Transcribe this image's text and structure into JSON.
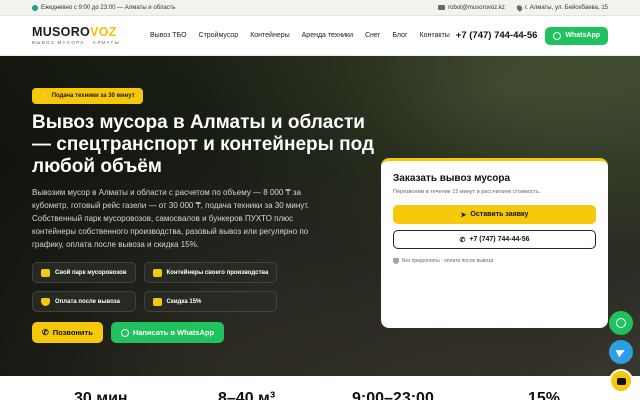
{
  "topbar": {
    "hours": "Ежедневно с 9:00 до 23:00 — Алматы и область",
    "email": "robot@musorovoz.kz",
    "address": "г. Алматы, ул. Бейсебаева, 15"
  },
  "header": {
    "logo_part1": "MUSORO",
    "logo_part2": "VOZ",
    "logo_sub": "ВЫВОЗ МУСОРА · АЛМАТЫ",
    "nav": [
      "Вывоз ТБО",
      "Строймусор",
      "Контейнеры",
      "Аренда техники",
      "Снег",
      "Блог",
      "Контакты"
    ],
    "phone": "+7 (747) 744-44-56",
    "whatsapp": "WhatsApp"
  },
  "hero": {
    "badge": "Подача техники за 30 минут",
    "title": "Вывоз мусора в Алматы и области — спецтранспорт и контейнеры под любой объём",
    "lead": "Вывозим мусор в Алматы и области с расчетом по объему — 8 000 ₸ за кубометр, готовый рейс газели — от 30 000 ₸, подача техники за 30 минут. Собственный парк мусоровозов, самосвалов и бункеров ПУХТО плюс контейнеры собственного производства, разовый вывоз или регулярно по графику, оплата после вывоза и скидка 15%.",
    "features": [
      "Свой парк мусоровозов",
      "Контейнеры своего производства",
      "Оплата после вывоза",
      "Скидка 15%"
    ],
    "call_btn": "Позвонить",
    "wa_btn": "Написать в WhatsApp"
  },
  "order_card": {
    "title": "Заказать вывоз мусора",
    "subtitle": "Перезвоним в течение 15 минут и рассчитаем стоимость.",
    "submit": "Оставить заявку",
    "phone": "+7 (747) 744-44-56",
    "note": "Без предоплаты · оплата после вывоза"
  },
  "stats": [
    "30 мин",
    "8–40 м³",
    "9:00–23:00",
    "15%"
  ],
  "colors": {
    "accent": "#f6c80a",
    "whatsapp": "#21c25e",
    "telegram": "#2d9ee0"
  }
}
